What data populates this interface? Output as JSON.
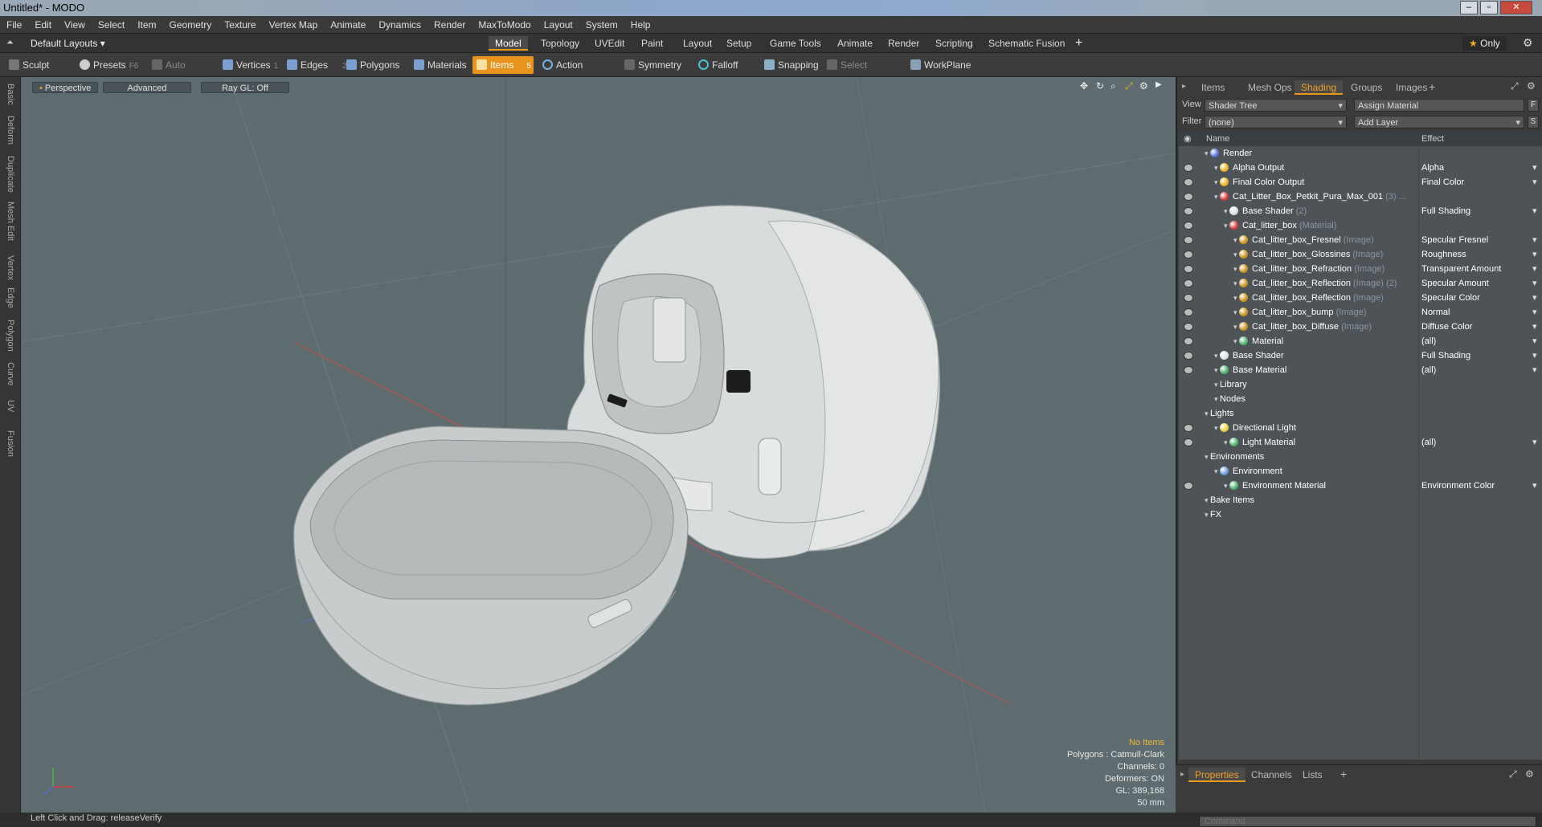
{
  "window": {
    "title": "Untitled* - MODO"
  },
  "menu": [
    "File",
    "Edit",
    "View",
    "Select",
    "Item",
    "Geometry",
    "Texture",
    "Vertex Map",
    "Animate",
    "Dynamics",
    "Render",
    "MaxToModo",
    "Layout",
    "System",
    "Help"
  ],
  "layoutbar": {
    "layout_select": "Default Layouts",
    "tabs": [
      "Model",
      "Topology",
      "UVEdit",
      "Paint",
      "Layout",
      "Setup",
      "Game Tools",
      "Animate",
      "Render",
      "Scripting",
      "Schematic Fusion"
    ],
    "active_tab": "Model",
    "only_label": "Only"
  },
  "toolbar": {
    "sculpt": "Sculpt",
    "presets": "Presets",
    "presets_key": "F6",
    "auto_select": "Auto Select",
    "vertices": "Vertices",
    "vertices_key": "1",
    "edges": "Edges",
    "edges_key": "2",
    "polygons": "Polygons",
    "materials": "Materials",
    "items": "Items",
    "items_key": "5",
    "action_center": "Action Center",
    "symmetry": "Symmetry",
    "falloff": "Falloff",
    "snapping": "Snapping",
    "select_through": "Select Through",
    "workplane": "WorkPlane"
  },
  "lefttabs": [
    "Basic",
    "Deform",
    "Duplicate",
    "Mesh Edit",
    "Vertex",
    "Edge",
    "Polygon",
    "Curve",
    "UV",
    "Fusion"
  ],
  "viewport": {
    "view_mode": "Perspective",
    "shading": "Advanced",
    "raygl": "Ray GL: Off",
    "info": {
      "selection": "No Items",
      "polygons": "Polygons : Catmull-Clark",
      "channels": "Channels: 0",
      "deformers": "Deformers: ON",
      "gl": "GL: 389,168",
      "scale": "50 mm"
    }
  },
  "rightpanel": {
    "tabs": [
      "Items",
      "Mesh Ops",
      "Shading",
      "Groups",
      "Images"
    ],
    "active_tab": "Shading",
    "view_label": "View",
    "view_value": "Shader Tree",
    "assign_material": "Assign Material",
    "filter_label": "Filter",
    "filter_value": "(none)",
    "add_layer": "Add Layer",
    "col_name": "Name",
    "col_effect": "Effect",
    "rows": [
      {
        "indent": 0,
        "name": "Render",
        "sub": "",
        "effect": "",
        "ball": "#5a6fd6",
        "eye": false
      },
      {
        "indent": 1,
        "name": "Alpha Output",
        "sub": "",
        "effect": "Alpha",
        "ball": "#e8b020",
        "eye": true
      },
      {
        "indent": 1,
        "name": "Final Color Output",
        "sub": "",
        "effect": "Final Color",
        "ball": "#e8b020",
        "eye": true
      },
      {
        "indent": 1,
        "name": "Cat_Litter_Box_Petkit_Pura_Max_001",
        "sub": "(3) ...",
        "effect": "",
        "ball": "#d23a3a",
        "eye": true
      },
      {
        "indent": 2,
        "name": "Base Shader",
        "sub": "(2)",
        "effect": "Full Shading",
        "ball": "#dddddd",
        "eye": true
      },
      {
        "indent": 2,
        "name": "Cat_litter_box",
        "sub": "(Material)",
        "effect": "",
        "ball": "#d23a3a",
        "eye": true
      },
      {
        "indent": 3,
        "name": "Cat_litter_box_Fresnel",
        "sub": "(Image)",
        "effect": "Specular Fresnel",
        "ball": "#c8901c",
        "eye": true
      },
      {
        "indent": 3,
        "name": "Cat_litter_box_Glossines",
        "sub": "(Image)",
        "effect": "Roughness",
        "ball": "#c8901c",
        "eye": true
      },
      {
        "indent": 3,
        "name": "Cat_litter_box_Refraction",
        "sub": "(Image)",
        "effect": "Transparent Amount",
        "ball": "#c8901c",
        "eye": true
      },
      {
        "indent": 3,
        "name": "Cat_litter_box_Reflection",
        "sub": "(Image) (2)",
        "effect": "Specular Amount",
        "ball": "#c8901c",
        "eye": true
      },
      {
        "indent": 3,
        "name": "Cat_litter_box_Reflection",
        "sub": "(Image)",
        "effect": "Specular Color",
        "ball": "#c8901c",
        "eye": true
      },
      {
        "indent": 3,
        "name": "Cat_litter_box_bump",
        "sub": "(Image)",
        "effect": "Normal",
        "ball": "#c8901c",
        "eye": true
      },
      {
        "indent": 3,
        "name": "Cat_litter_box_Diffuse",
        "sub": "(Image)",
        "effect": "Diffuse Color",
        "ball": "#c8901c",
        "eye": true
      },
      {
        "indent": 3,
        "name": "Material",
        "sub": "",
        "effect": "(all)",
        "ball": "#4cb06a",
        "eye": true
      },
      {
        "indent": 1,
        "name": "Base Shader",
        "sub": "",
        "effect": "Full Shading",
        "ball": "#dddddd",
        "eye": true
      },
      {
        "indent": 1,
        "name": "Base Material",
        "sub": "",
        "effect": "(all)",
        "ball": "#4cb06a",
        "eye": true
      },
      {
        "indent": 1,
        "name": "Library",
        "sub": "",
        "effect": "",
        "ball": "",
        "eye": false
      },
      {
        "indent": 1,
        "name": "Nodes",
        "sub": "",
        "effect": "",
        "ball": "",
        "eye": false
      },
      {
        "indent": 0,
        "name": "Lights",
        "sub": "",
        "effect": "",
        "ball": "",
        "eye": false
      },
      {
        "indent": 1,
        "name": "Directional Light",
        "sub": "",
        "effect": "",
        "ball": "#e8d040",
        "eye": true
      },
      {
        "indent": 2,
        "name": "Light Material",
        "sub": "",
        "effect": "(all)",
        "ball": "#4cb06a",
        "eye": true
      },
      {
        "indent": 0,
        "name": "Environments",
        "sub": "",
        "effect": "",
        "ball": "",
        "eye": false
      },
      {
        "indent": 1,
        "name": "Environment",
        "sub": "",
        "effect": "",
        "ball": "#6a9ad6",
        "eye": false
      },
      {
        "indent": 2,
        "name": "Environment Material",
        "sub": "",
        "effect": "Environment Color",
        "ball": "#4cb06a",
        "eye": true
      },
      {
        "indent": 0,
        "name": "Bake Items",
        "sub": "",
        "effect": "",
        "ball": "",
        "eye": false
      },
      {
        "indent": 0,
        "name": "FX",
        "sub": "",
        "effect": "",
        "ball": "",
        "eye": false
      }
    ]
  },
  "bottompanel": {
    "tabs": [
      "Properties",
      "Channels",
      "Lists"
    ],
    "active_tab": "Properties",
    "command_placeholder": "Command"
  },
  "status": {
    "hint": "Left Click and Drag:  releaseVerify"
  }
}
